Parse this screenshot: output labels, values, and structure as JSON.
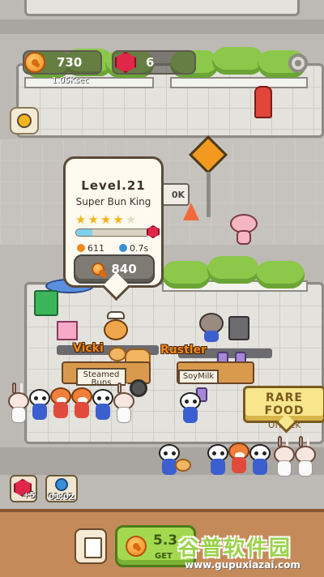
{
  "hud": {
    "coins": "730",
    "coin_rate": "1.05K",
    "coin_rate_unit": "sec",
    "gems": "6"
  },
  "stall_left": {
    "worker_name": "Vicki",
    "sign": "Steamed Buns"
  },
  "stall_right": {
    "worker_name": "Rustler",
    "sign": "SoyMilk"
  },
  "popup": {
    "level": "Level.21",
    "name": "Super Bun King",
    "stars_filled": 4,
    "stars_total": 5,
    "progress": 0.22,
    "stat_income": "611",
    "stat_time": "0.7s",
    "upgrade_cost": "840"
  },
  "partial_sign": "0K",
  "rare_food": {
    "title": "RARE FOOD",
    "action": "Unlock"
  },
  "boosts": {
    "gem_count": "+5",
    "timer": "01:02"
  },
  "bottom": {
    "earn_value": "5.3",
    "earn_label": "GET"
  },
  "watermark": {
    "text": "谷普软件园",
    "url": "www.gupuxiazai.com"
  },
  "colors": {
    "coin": "#f08a1c",
    "gem": "#e0274a",
    "bush": "#8cc84a",
    "accent_name": "#f08a1c"
  }
}
